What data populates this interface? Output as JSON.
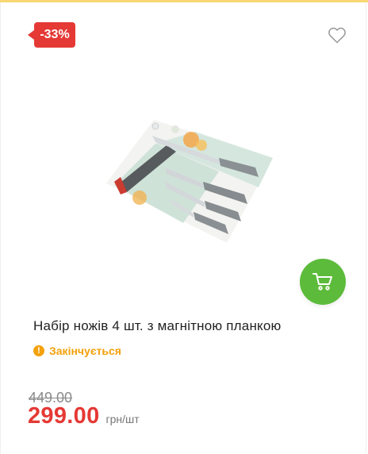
{
  "badge": {
    "discount": "-33%"
  },
  "product": {
    "title": "Набір ножів 4 шт. з магнітною планкою",
    "status": "Закінчується",
    "old_price": "449.00",
    "price": "299.00",
    "unit": "грн/шт"
  },
  "icons": {
    "wishlist": "heart-outline",
    "cart": "shopping-cart",
    "status": "exclamation-circle"
  },
  "colors": {
    "accent_red": "#e53935",
    "cart_green": "#5cbb3a",
    "status_orange": "#f3a10c"
  }
}
